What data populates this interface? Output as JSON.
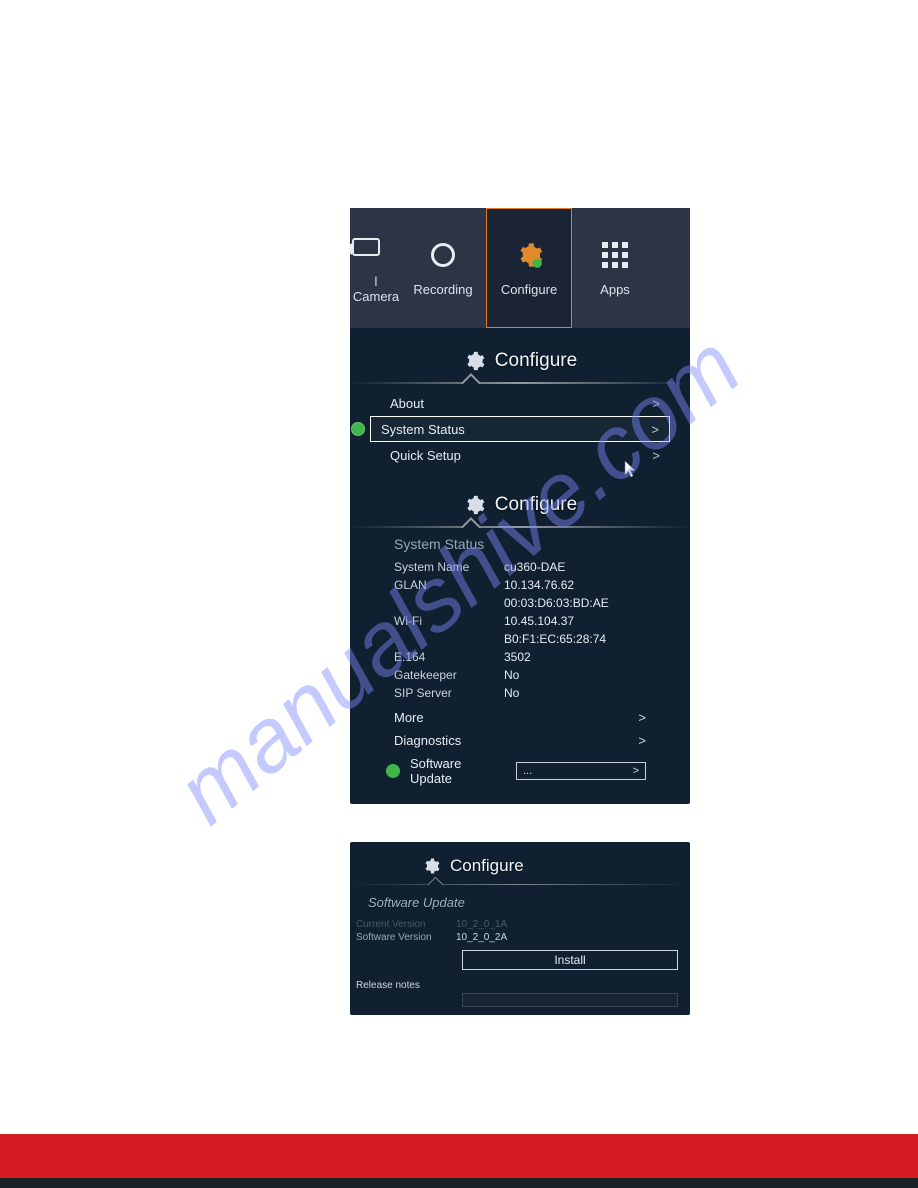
{
  "watermark": "manualshive.com",
  "tabs": {
    "camera": "l Camera",
    "recording": "Recording",
    "configure": "Configure",
    "apps": "Apps"
  },
  "panel1": {
    "header": "Configure",
    "menu": {
      "about": "About",
      "system_status": "System Status",
      "quick_setup": "Quick Setup"
    },
    "header2": "Configure",
    "detail_header": "System Status",
    "kv": {
      "system_name": {
        "k": "System Name",
        "v": "cu360-DAE"
      },
      "glan": {
        "k": "GLAN",
        "v": "10.134.76.62"
      },
      "glan_mac": {
        "k": "",
        "v": "00:03:D6:03:BD:AE"
      },
      "wifi": {
        "k": "Wi-Fi",
        "v": "10.45.104.37"
      },
      "wifi_mac": {
        "k": "",
        "v": "B0:F1:EC:65:28:74"
      },
      "e164": {
        "k": "E.164",
        "v": "3502"
      },
      "gatekeeper": {
        "k": "Gatekeeper",
        "v": "No"
      },
      "sip": {
        "k": "SIP Server",
        "v": "No"
      }
    },
    "more": "More",
    "diagnostics": "Diagnostics",
    "software_update": "Software Update",
    "update_box": "..."
  },
  "panel2": {
    "header": "Configure",
    "subhead": "Software Update",
    "current": {
      "k": "Current Version",
      "v": "10_2_0_1A"
    },
    "sw": {
      "k": "Software Version",
      "v": "10_2_0_2A"
    },
    "install": "Install",
    "release_notes": "Release notes"
  }
}
